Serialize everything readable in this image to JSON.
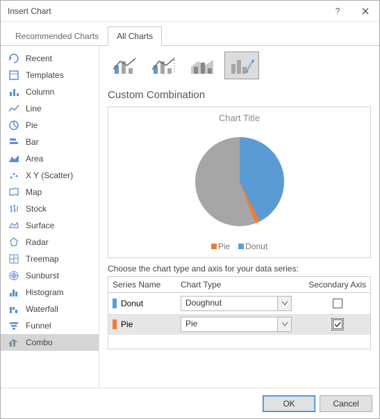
{
  "window": {
    "title": "Insert Chart"
  },
  "tabs": {
    "recommended": "Recommended Charts",
    "all": "All Charts"
  },
  "sidebar": {
    "items": [
      {
        "label": "Recent"
      },
      {
        "label": "Templates"
      },
      {
        "label": "Column"
      },
      {
        "label": "Line"
      },
      {
        "label": "Pie"
      },
      {
        "label": "Bar"
      },
      {
        "label": "Area"
      },
      {
        "label": "X Y (Scatter)"
      },
      {
        "label": "Map"
      },
      {
        "label": "Stock"
      },
      {
        "label": "Surface"
      },
      {
        "label": "Radar"
      },
      {
        "label": "Treemap"
      },
      {
        "label": "Sunburst"
      },
      {
        "label": "Histogram"
      },
      {
        "label": "Waterfall"
      },
      {
        "label": "Funnel"
      },
      {
        "label": "Combo"
      }
    ],
    "selected_index": 17
  },
  "main": {
    "section_title": "Custom Combination",
    "preview_title": "Chart Title",
    "legend": {
      "pie": "Pie",
      "donut": "Donut"
    },
    "instruction": "Choose the chart type and axis for your data series:",
    "grid": {
      "headers": {
        "name": "Series Name",
        "type": "Chart Type",
        "axis": "Secondary Axis"
      },
      "rows": [
        {
          "color": "#5b9bd5",
          "name": "Donut",
          "type": "Doughnut",
          "secondary": false
        },
        {
          "color": "#ed7d31",
          "name": "Pie",
          "type": "Pie",
          "secondary": true
        }
      ]
    }
  },
  "footer": {
    "ok": "OK",
    "cancel": "Cancel"
  },
  "chart_data": {
    "type": "pie",
    "title": "Chart Title",
    "series": [
      {
        "name": "Donut",
        "color": "#5b9bd5",
        "value": 40
      },
      {
        "name": "Pie",
        "color": "#a6a6a6",
        "value": 60
      }
    ],
    "notes": "Preview pie shows approx 40% blue (Donut) on right, 60% gray slice; thin orange sliver at seam."
  }
}
